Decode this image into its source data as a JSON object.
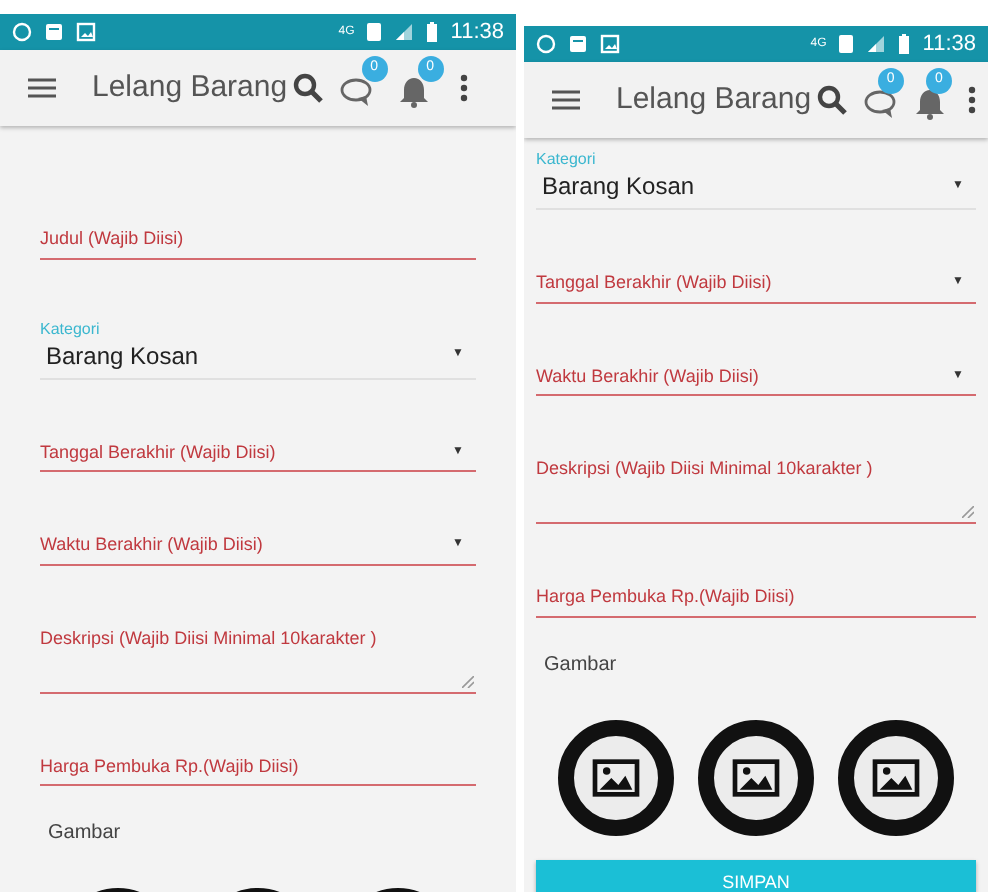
{
  "screens": [
    {
      "status_bar": {
        "time": "11:38",
        "network": "4G"
      },
      "toolbar": {
        "title": "Lelang Barang",
        "chat_badge": "0",
        "notification_badge": "0"
      },
      "form": [
        {
          "kind": "text",
          "placeholder": "Judul (Wajib Diisi)"
        },
        {
          "kind": "select",
          "label": "Kategori",
          "value": "Barang Kosan",
          "caret": "▼"
        },
        {
          "kind": "select",
          "placeholder": "Tanggal Berakhir (Wajib Diisi)",
          "caret": "▼"
        },
        {
          "kind": "select",
          "placeholder": "Waktu Berakhir (Wajib Diisi)",
          "caret": "▼"
        },
        {
          "kind": "textarea",
          "placeholder": "Deskripsi (Wajib Diisi Minimal 10karakter )"
        },
        {
          "kind": "text",
          "placeholder": "Harga Pembuka Rp.(Wajib Diisi)"
        }
      ],
      "images_label": "Gambar",
      "images": [
        {
          "kind": "placeholder"
        },
        {
          "kind": "placeholder"
        },
        {
          "kind": "placeholder"
        }
      ]
    },
    {
      "status_bar": {
        "time": "11:38",
        "network": "4G"
      },
      "toolbar": {
        "title": "Lelang Barang",
        "chat_badge": "0",
        "notification_badge": "0"
      },
      "form": [
        {
          "kind": "select",
          "label": "Kategori",
          "value": "Barang Kosan",
          "caret": "▼"
        },
        {
          "kind": "select",
          "placeholder": "Tanggal Berakhir (Wajib Diisi)",
          "caret": "▼"
        },
        {
          "kind": "select",
          "placeholder": "Waktu Berakhir (Wajib Diisi)",
          "caret": "▼"
        },
        {
          "kind": "textarea",
          "placeholder": "Deskripsi (Wajib Diisi Minimal 10karakter )"
        },
        {
          "kind": "text",
          "placeholder": "Harga Pembuka Rp.(Wajib Diisi)"
        }
      ],
      "images_label": "Gambar",
      "images": [
        {
          "kind": "placeholder"
        },
        {
          "kind": "placeholder"
        },
        {
          "kind": "placeholder"
        }
      ],
      "save_button": "SIMPAN"
    }
  ]
}
